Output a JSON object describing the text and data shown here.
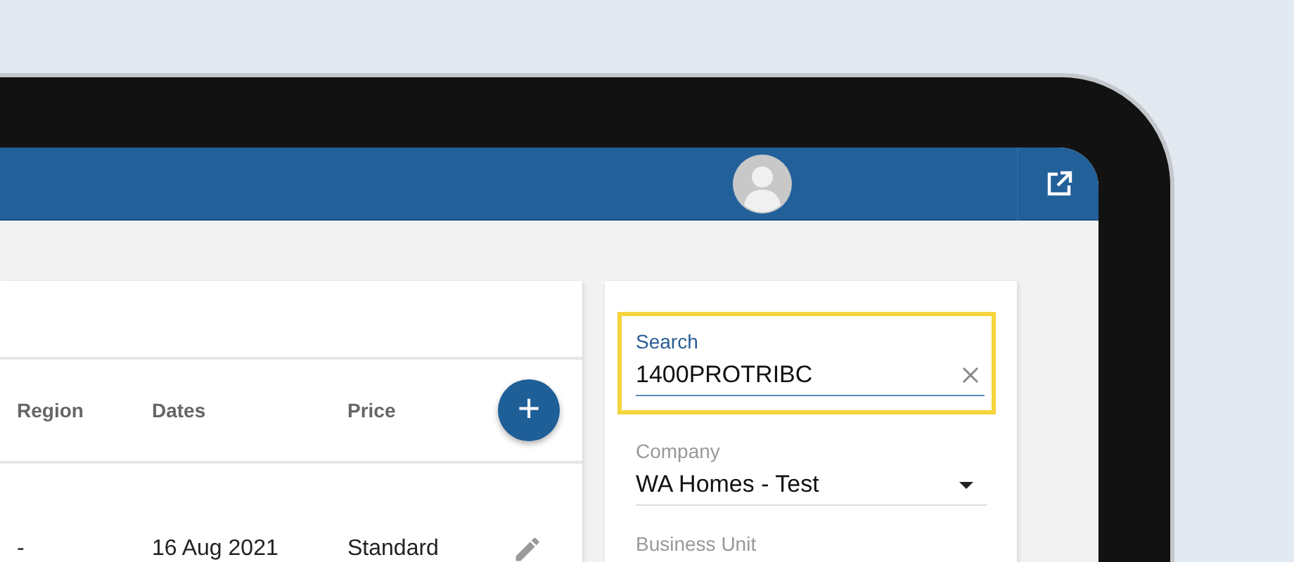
{
  "table": {
    "columns": [
      "Region",
      "Dates",
      "Price"
    ],
    "add_button": "+",
    "rows": [
      {
        "cells": [
          "-",
          "16 Aug 2021",
          "Standard"
        ]
      }
    ]
  },
  "filters": {
    "search": {
      "label": "Search",
      "value": "1400PROTRIBC",
      "highlighted": true
    },
    "company": {
      "label": "Company",
      "value": "WA Homes - Test"
    },
    "business_unit": {
      "label": "Business Unit"
    }
  }
}
